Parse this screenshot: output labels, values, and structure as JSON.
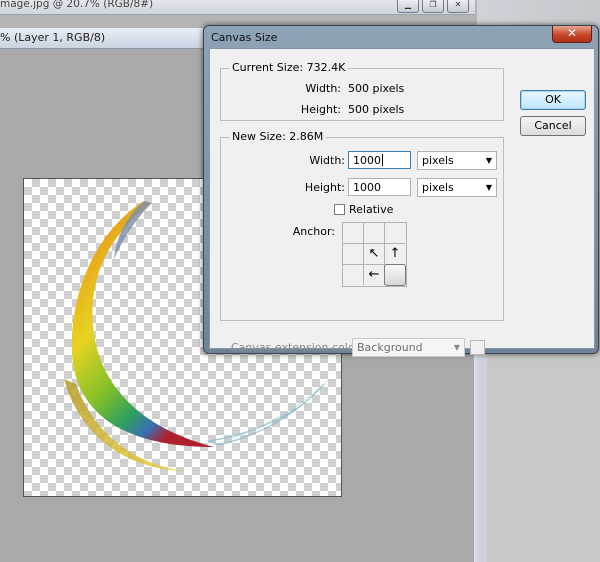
{
  "background": {
    "top_window_title": "mage.jpg @ 20.7% (RGB/8#)",
    "top_window_buttons": [
      "minimize",
      "restore",
      "close"
    ],
    "doc_window_title": "% (Layer 1, RGB/8)"
  },
  "dialog": {
    "title": "Canvas Size",
    "close_glyph": "✕",
    "current_size": {
      "label": "Current Size: 732.4K",
      "width_label": "Width:",
      "width_value": "500 pixels",
      "height_label": "Height:",
      "height_value": "500 pixels"
    },
    "new_size": {
      "label": "New Size: 2.86M",
      "width_label": "Width:",
      "width_value": "1000",
      "width_unit": "pixels",
      "height_label": "Height:",
      "height_value": "1000",
      "height_unit": "pixels",
      "relative_label": "Relative",
      "relative_checked": false,
      "anchor_label": "Anchor:",
      "anchor_cells": [
        "",
        "",
        "",
        "",
        "↖",
        "↑",
        "",
        "←",
        ""
      ],
      "anchor_selected_index": 8
    },
    "extension_label": "Canvas extension color:",
    "extension_value": "Background",
    "ok_label": "OK",
    "cancel_label": "Cancel"
  },
  "colors": {
    "dialog_frame": "#7f93a7",
    "close_button": "#c8452a",
    "default_button_border": "#3c7fb1"
  }
}
